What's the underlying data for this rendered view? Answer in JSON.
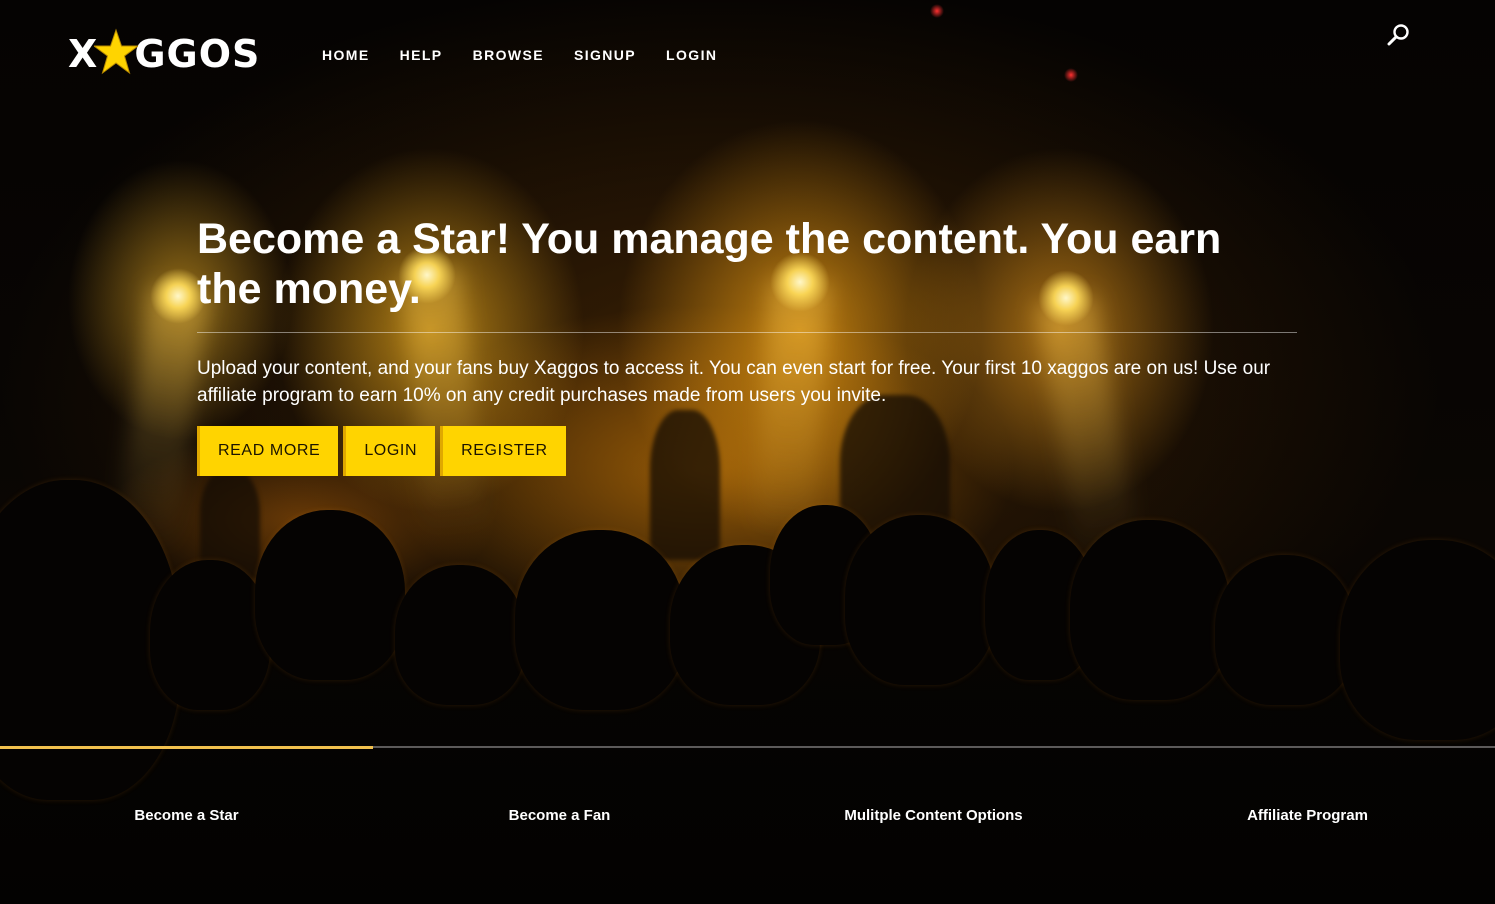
{
  "brand": {
    "logo_text_left": "X",
    "logo_text_right": "GGOS",
    "accent": "#ffd400"
  },
  "nav": {
    "items": [
      {
        "label": "HOME"
      },
      {
        "label": "HELP"
      },
      {
        "label": "BROWSE"
      },
      {
        "label": "SIGNUP"
      },
      {
        "label": "LOGIN"
      }
    ]
  },
  "search": {
    "icon": "search-icon"
  },
  "hero": {
    "headline": "Become a Star! You manage the content. You earn the money.",
    "description": "Upload your content, and your fans buy Xaggos to access it. You can even start for free. Your first 10 xaggos are on us! Use our affiliate program to earn 10% on any credit purchases made from users you invite.",
    "buttons": {
      "read_more": "READ MORE",
      "login": "LOGIN",
      "register": "REGISTER"
    }
  },
  "tabs": {
    "items": [
      {
        "label": "Become a Star",
        "active": true
      },
      {
        "label": "Become a Fan"
      },
      {
        "label": "Mulitple Content Options"
      },
      {
        "label": "Affiliate Program"
      }
    ],
    "active_color": "#f2c14e"
  }
}
